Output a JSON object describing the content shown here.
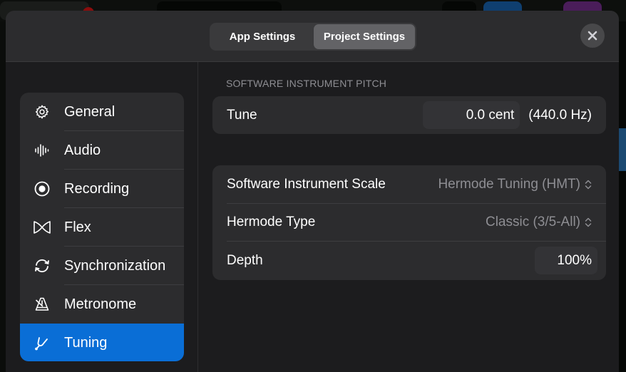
{
  "segmented_control": {
    "tabs": [
      {
        "label": "App Settings",
        "active": false
      },
      {
        "label": "Project Settings",
        "active": true
      }
    ]
  },
  "close_button": {
    "icon": "close-icon"
  },
  "sidebar": {
    "selected": "Tuning",
    "items": [
      {
        "label": "General",
        "icon": "gear-icon"
      },
      {
        "label": "Audio",
        "icon": "waveform-icon"
      },
      {
        "label": "Recording",
        "icon": "record-circle-icon"
      },
      {
        "label": "Flex",
        "icon": "flex-icon"
      },
      {
        "label": "Synchronization",
        "icon": "sync-arrows-icon"
      },
      {
        "label": "Metronome",
        "icon": "metronome-icon"
      },
      {
        "label": "Tuning",
        "icon": "tuning-fork-icon"
      }
    ]
  },
  "pitch_section": {
    "title": "SOFTWARE INSTRUMENT PITCH",
    "tune": {
      "label": "Tune",
      "value": "0.0 cent",
      "frequency": "(440.0 Hz)"
    }
  },
  "scale_section": {
    "scale": {
      "label": "Software Instrument Scale",
      "value": "Hermode Tuning (HMT)"
    },
    "hermode_type": {
      "label": "Hermode Type",
      "value": "Classic (3/5-All)"
    },
    "depth": {
      "label": "Depth",
      "value": "100%"
    }
  },
  "colors": {
    "accent": "#0a6ed6",
    "panel": "#2c2c2e",
    "background": "#1c1c1e",
    "secondary_text": "#8e8e93"
  }
}
